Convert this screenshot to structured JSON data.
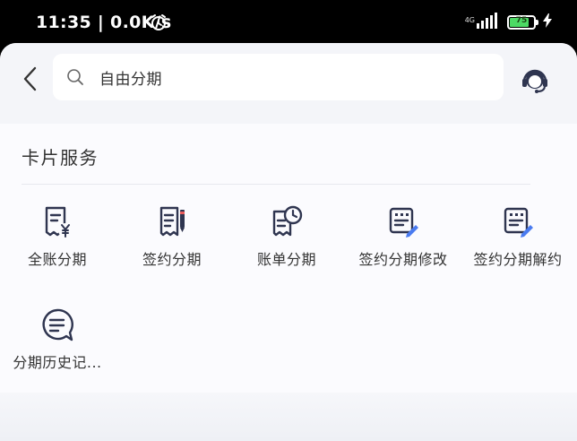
{
  "status_bar": {
    "time": "11:35 | 0.0K/s",
    "network_label": "4G",
    "battery_level": "75"
  },
  "search": {
    "query": "自由分期"
  },
  "card_services": {
    "title": "卡片服务",
    "items": [
      {
        "label": "全账分期",
        "icon": "bill-yuan-icon"
      },
      {
        "label": "签约分期",
        "icon": "contract-pen-icon"
      },
      {
        "label": "账单分期",
        "icon": "bill-clock-icon"
      },
      {
        "label": "签约分期修改",
        "icon": "contract-edit-icon"
      },
      {
        "label": "签约分期解约",
        "icon": "contract-edit-icon"
      },
      {
        "label": "分期历史记...",
        "icon": "chat-history-icon"
      }
    ]
  },
  "colors": {
    "icon_color": "#2f3550",
    "accent_blue": "#4a7bf0",
    "page_background": "#f4f5f9"
  }
}
